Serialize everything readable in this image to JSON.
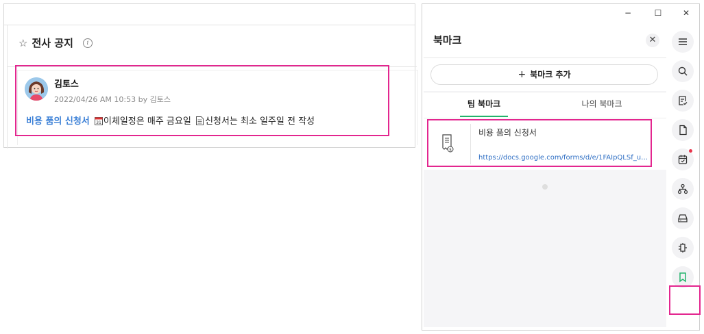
{
  "notice": {
    "title": "전사 공지",
    "post": {
      "author": "김토스",
      "meta": "2022/04/26 AM 10:53 by 김토스",
      "link_text": "비용 품의 신청서",
      "text_part1": "이체일정은 매주 금요일",
      "text_part2": "신청서는 최소 일주일 전 작성"
    }
  },
  "window": {
    "controls": {
      "minimize": "−",
      "maximize": "☐",
      "close": "✕"
    }
  },
  "bookmark_panel": {
    "title": "북마크",
    "close": "✕",
    "add_button_plus": "+",
    "add_button": "북마크 추가",
    "tabs": [
      {
        "label": "팀 북마크",
        "active": true
      },
      {
        "label": "나의 북마크",
        "active": false
      }
    ],
    "items": [
      {
        "title": "비용 품의 신청서",
        "url": "https://docs.google.com/forms/d/e/1FAIpQLSf_ujj..."
      }
    ]
  },
  "rail": {
    "icons": [
      "menu-icon",
      "search-icon",
      "task-icon",
      "document-icon",
      "calendar-icon",
      "org-chart-icon",
      "drive-icon",
      "integration-icon",
      "bookmark-icon"
    ],
    "accent_color": "#23b36b",
    "badge_color": "#e8344a"
  },
  "highlight_color": "#e3268f"
}
